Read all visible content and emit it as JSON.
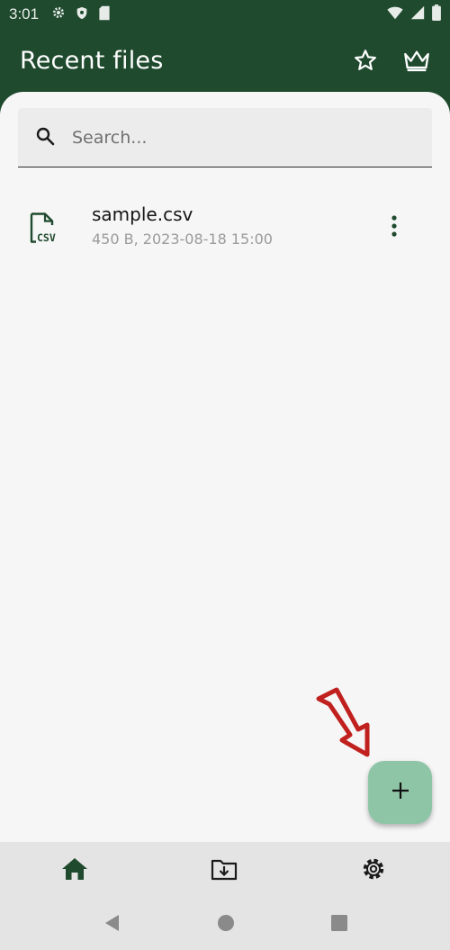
{
  "status_bar": {
    "time": "3:01",
    "left_icons": [
      "settings-icon",
      "shield-icon",
      "sd-card-icon"
    ],
    "right_icons": [
      "wifi-icon",
      "signal-icon",
      "battery-icon"
    ]
  },
  "app_bar": {
    "title": "Recent files",
    "actions": [
      "star-icon",
      "crown-icon"
    ]
  },
  "search": {
    "placeholder": "Search...",
    "value": ""
  },
  "files": [
    {
      "name": "sample.csv",
      "meta": "450 B, 2023-08-18 15:00",
      "icon": "csv-file-icon",
      "icon_label": "CSV"
    }
  ],
  "fab": {
    "icon": "plus-icon"
  },
  "bottom_nav": [
    "home-icon",
    "folder-download-icon",
    "gear-icon"
  ],
  "system_nav": [
    "back-icon",
    "home-circle-icon",
    "recents-icon"
  ],
  "colors": {
    "primary": "#1f4a2e",
    "fab": "#8fc5a7",
    "background": "#f6f6f6",
    "annotation": "#c0201e"
  }
}
